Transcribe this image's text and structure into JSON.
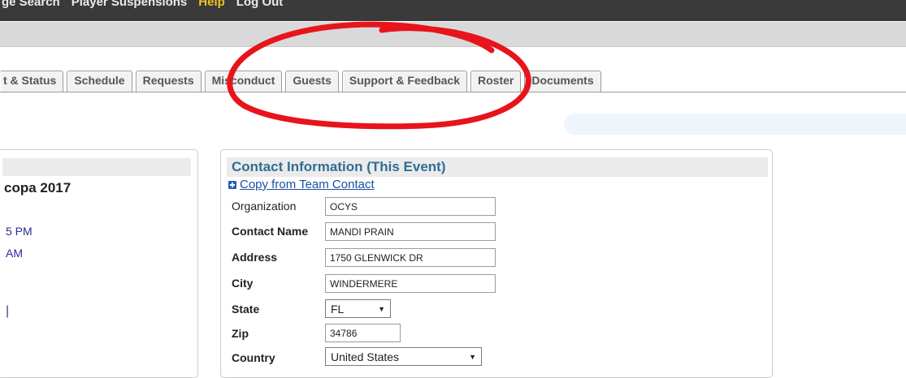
{
  "topnav": {
    "items": [
      {
        "label": "ge Search",
        "cls": ""
      },
      {
        "label": "Player Suspensions",
        "cls": ""
      },
      {
        "label": "Help",
        "cls": "help"
      },
      {
        "label": "Log Out",
        "cls": ""
      }
    ]
  },
  "tabs": [
    "t & Status",
    "Schedule",
    "Requests",
    "Misconduct",
    "Guests",
    "Support & Feedback",
    "Roster",
    "Documents"
  ],
  "left_panel": {
    "title": "copa 2017",
    "time1": "5 PM",
    "time2": "AM",
    "pipe": "|"
  },
  "contact": {
    "title": "Contact Information (This Event)",
    "copy_link": "Copy from Team Contact",
    "labels": {
      "organization": "Organization",
      "contact_name": "Contact Name",
      "address": "Address",
      "city": "City",
      "state": "State",
      "zip": "Zip",
      "country": "Country"
    },
    "values": {
      "organization": "OCYS",
      "contact_name": "MANDI PRAIN",
      "address": "1750 GLENWICK DR",
      "city": "WINDERMERE",
      "state": "FL",
      "zip": "34786",
      "country": "United States"
    }
  },
  "annotation": {
    "color": "#e8141b"
  }
}
